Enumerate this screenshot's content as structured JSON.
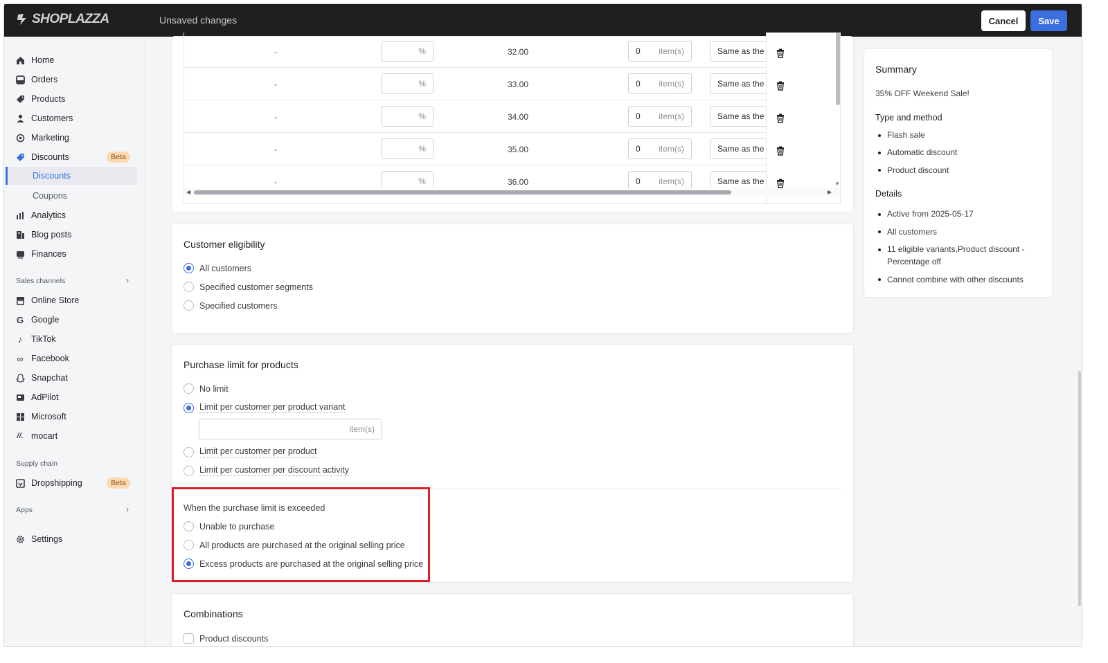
{
  "header": {
    "logo_text": "SHOPLAZZA",
    "status": "Unsaved changes",
    "cancel_label": "Cancel",
    "save_label": "Save"
  },
  "sidebar": {
    "items": [
      {
        "label": "Home",
        "icon": "home-icon"
      },
      {
        "label": "Orders",
        "icon": "orders-icon"
      },
      {
        "label": "Products",
        "icon": "tag-icon"
      },
      {
        "label": "Customers",
        "icon": "person-icon"
      },
      {
        "label": "Marketing",
        "icon": "marketing-icon"
      },
      {
        "label": "Discounts",
        "icon": "discount-icon",
        "badge": "Beta"
      },
      {
        "label": "Analytics",
        "icon": "bar-chart-icon"
      },
      {
        "label": "Blog posts",
        "icon": "blog-icon"
      },
      {
        "label": "Finances",
        "icon": "finance-icon"
      }
    ],
    "discount_sub": [
      "Discounts",
      "Coupons"
    ],
    "sales_channels_label": "Sales channels",
    "channels": [
      {
        "label": "Online Store",
        "icon": "store-icon"
      },
      {
        "label": "Google",
        "icon": "google-icon"
      },
      {
        "label": "TikTok",
        "icon": "tiktok-icon"
      },
      {
        "label": "Facebook",
        "icon": "meta-icon"
      },
      {
        "label": "Snapchat",
        "icon": "snapchat-icon"
      },
      {
        "label": "AdPilot",
        "icon": "adpilot-icon"
      },
      {
        "label": "Microsoft",
        "icon": "microsoft-icon"
      },
      {
        "label": "mocart",
        "icon": "mocart-icon"
      }
    ],
    "supply_chain_label": "Supply chain",
    "dropshipping": {
      "label": "Dropshipping",
      "badge": "Beta"
    },
    "apps_label": "Apps",
    "settings_label": "Settings"
  },
  "variant_table": {
    "rows": [
      {
        "dash": "-",
        "pct_unit": "%",
        "price": "32.00",
        "qty": "0",
        "qty_unit": "item(s)",
        "select": "Same as the p"
      },
      {
        "dash": "-",
        "pct_unit": "%",
        "price": "33.00",
        "qty": "0",
        "qty_unit": "item(s)",
        "select": "Same as the p"
      },
      {
        "dash": "-",
        "pct_unit": "%",
        "price": "34.00",
        "qty": "0",
        "qty_unit": "item(s)",
        "select": "Same as the p"
      },
      {
        "dash": "-",
        "pct_unit": "%",
        "price": "35.00",
        "qty": "0",
        "qty_unit": "item(s)",
        "select": "Same as the p"
      },
      {
        "dash": "-",
        "pct_unit": "%",
        "price": "36.00",
        "qty": "0",
        "qty_unit": "item(s)",
        "select": "Same as the p"
      }
    ]
  },
  "eligibility": {
    "title": "Customer eligibility",
    "options": [
      "All customers",
      "Specified customer segments",
      "Specified customers"
    ],
    "selected": "All customers"
  },
  "purchase_limit": {
    "title": "Purchase limit for products",
    "options": [
      "No limit",
      "Limit per customer per product variant",
      "Limit per customer per product",
      "Limit per customer per discount activity"
    ],
    "selected": "Limit per customer per product variant",
    "unit": "item(s)",
    "exceeded_label": "When the purchase limit is exceeded",
    "exceeded_options": [
      "Unable to purchase",
      "All products are purchased at the original selling price",
      "Excess products are purchased at the original selling price"
    ],
    "exceeded_selected": "Excess products are purchased at the original selling price"
  },
  "combinations": {
    "title": "Combinations",
    "options": [
      "Product discounts"
    ]
  },
  "summary": {
    "title": "Summary",
    "name": "35% OFF Weekend Sale!",
    "type_heading": "Type and method",
    "type_items": [
      "Flash sale",
      "Automatic discount",
      "Product discount"
    ],
    "details_heading": "Details",
    "details_items": [
      "Active from 2025-05-17",
      "All customers",
      "11 eligible variants,Product discount -",
      "Percentage off",
      "Cannot combine with other discounts"
    ]
  },
  "colors": {
    "accent": "#3b6fe0",
    "topbar": "#1f1f1f",
    "highlight": "#d61f26",
    "beta_bg": "#fcd9b0"
  }
}
